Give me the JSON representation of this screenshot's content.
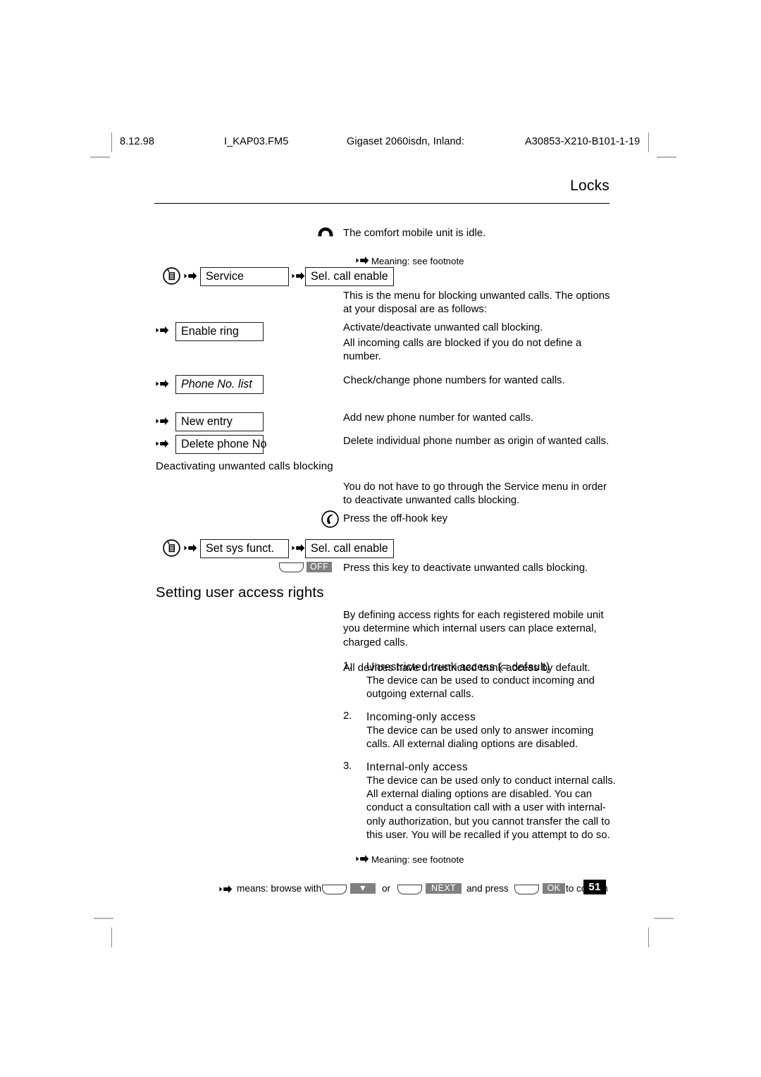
{
  "header": {
    "date": "8.12.98",
    "filename": "I_KAP03.FM5",
    "product": "Gigaset 2060isdn, Inland:",
    "doc_code": "A30853-X210-B101-1-19"
  },
  "chapter_title": "Locks",
  "idle_note": "The comfort mobile unit is idle.",
  "footnote_top": "Meaning: see footnote",
  "menu_row_1": {
    "menu_label": "Service",
    "submenu_label": "Sel. call enable"
  },
  "intro_text": "This is the menu for blocking unwanted calls. The options at your disposal are as follows:",
  "options": [
    {
      "label": "Enable ring",
      "italic": false,
      "desc_1": "Activate/deactivate unwanted call blocking.",
      "desc_2": "All incoming calls are blocked if you do not define a number."
    },
    {
      "label": "Phone No. list",
      "italic": true,
      "desc_1": "Check/change phone numbers for wanted calls.",
      "desc_2": ""
    },
    {
      "label": "New entry",
      "italic": false,
      "desc_1": "Add new phone number for wanted calls.",
      "desc_2": ""
    },
    {
      "label": "Delete phone No",
      "italic": false,
      "desc_1": "Delete individual phone number as origin of wanted calls.",
      "desc_2": ""
    }
  ],
  "deactivating": {
    "subheading": "Deactivating unwanted calls blocking",
    "body": "You do not have to go through the Service menu in order to deactivate unwanted calls blocking.",
    "offhook_instruction": "Press the off-hook key",
    "menu_label": "Set sys funct.",
    "submenu_label": "Sel. call enable",
    "softkey_display": "OFF",
    "softkey_instruction": "Press this key to deactivate unwanted calls blocking."
  },
  "section": {
    "heading": "Setting user access rights",
    "intro_1": "By defining access rights for each registered mobile unit you determine which internal users can place external, charged calls.",
    "intro_2": "All devices have unrestricted trunk access by default.",
    "items": [
      {
        "num": "1.",
        "heading": "Unrestricted trunk access (= default)",
        "body": "The device can be used to conduct incoming and outgoing external calls."
      },
      {
        "num": "2.",
        "heading": "Incoming-only access",
        "body": "The device can be used only to answer incoming calls. All external dialing options are disabled."
      },
      {
        "num": "3.",
        "heading": "Internal-only access",
        "body": "The device can be used only to conduct internal calls. All external dialing options are disabled. You can conduct a consultation call with a user with internal-only authorization, but you cannot transfer the call to this user. You will be recalled if you attempt to do so."
      }
    ]
  },
  "footer": {
    "footnote": "Meaning: see footnote",
    "legend_1": "means: browse with",
    "legend_or": "or",
    "legend_2": "and press",
    "legend_3": "to confirm",
    "key_down_label": "▼",
    "key_next_label": "NEXT",
    "key_ok_label": "OK",
    "page_number": "51"
  },
  "colors": {
    "display_gray": "#808080",
    "page_number_bg": "#000000",
    "rule": "#000000"
  }
}
